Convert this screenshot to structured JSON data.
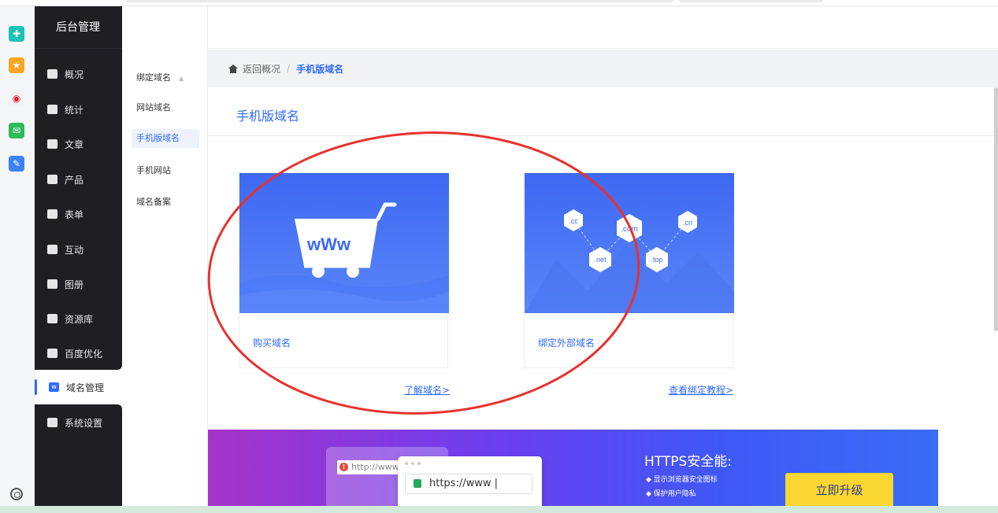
{
  "sidebar": {
    "title": "后台管理",
    "items": [
      {
        "label": "概况",
        "icon": "home-icon"
      },
      {
        "label": "统计",
        "icon": "chart-icon"
      },
      {
        "label": "文章",
        "icon": "article-icon"
      },
      {
        "label": "产品",
        "icon": "product-icon"
      },
      {
        "label": "表单",
        "icon": "form-icon"
      },
      {
        "label": "互动",
        "icon": "chat-icon"
      },
      {
        "label": "图册",
        "icon": "album-icon"
      },
      {
        "label": "资源库",
        "icon": "database-icon"
      },
      {
        "label": "百度优化",
        "icon": "baidu-icon"
      }
    ],
    "active_item": {
      "label": "域名管理",
      "icon": "domain-icon"
    },
    "system": {
      "label": "系统设置",
      "icon": "gear-icon"
    }
  },
  "subnav": {
    "group": "绑定域名",
    "items": [
      "网站域名",
      "手机版域名",
      "手机网站",
      "域名备案"
    ],
    "active": "手机版域名"
  },
  "breadcrumb": {
    "back": "返回概况",
    "separator": "/",
    "current": "手机版域名"
  },
  "page": {
    "title": "手机版域名"
  },
  "cards": [
    {
      "label": "购买域名",
      "link": "了解域名>"
    },
    {
      "label": "绑定外部域名",
      "link": "查看绑定教程>"
    }
  ],
  "domain_tags": [
    ".cc",
    ".com",
    ".cn",
    ".net",
    ".top"
  ],
  "banner": {
    "old_url": "http://www",
    "new_url": "https://www |",
    "title": "HTTPS安全能:",
    "bullets": [
      "显示浏览器安全图标",
      "保护用户隐私"
    ],
    "button": "立即升级"
  },
  "colors": {
    "accent": "#2f6bff",
    "sidebar_bg": "#1f1f22",
    "annotation": "#e8322e",
    "upgrade_button": "#fad631"
  }
}
